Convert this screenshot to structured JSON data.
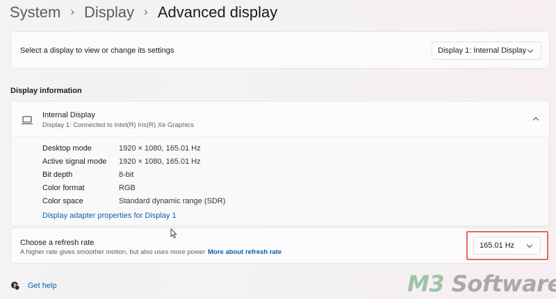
{
  "breadcrumb": {
    "items": [
      "System",
      "Display"
    ],
    "separator": "›",
    "current": "Advanced display"
  },
  "display_select": {
    "prompt": "Select a display to view or change its settings",
    "selected": "Display 1: Internal Display"
  },
  "display_information": {
    "heading": "Display information",
    "title": "Internal Display",
    "subtitle": "Display 1: Connected to Intel(R) Iris(R) Xe Graphics",
    "details": [
      {
        "label": "Desktop mode",
        "value": "1920 × 1080, 165.01 Hz"
      },
      {
        "label": "Active signal mode",
        "value": "1920 × 1080, 165.01 Hz"
      },
      {
        "label": "Bit depth",
        "value": "8-bit"
      },
      {
        "label": "Color format",
        "value": "RGB"
      },
      {
        "label": "Color space",
        "value": "Standard dynamic range (SDR)"
      }
    ],
    "adapter_link": "Display adapter properties for Display 1"
  },
  "refresh_rate": {
    "title": "Choose a refresh rate",
    "description": "A higher rate gives smoother motion, but also uses more power",
    "link": "More about refresh rate",
    "selected": "165.01 Hz",
    "highlight_color": "#e06b55"
  },
  "help": {
    "label": "Get help"
  },
  "watermark": {
    "prefix": "M3",
    "suffix": " Software"
  },
  "colors": {
    "link": "#0f5bb0",
    "card_bg": "#fbfbfb"
  }
}
